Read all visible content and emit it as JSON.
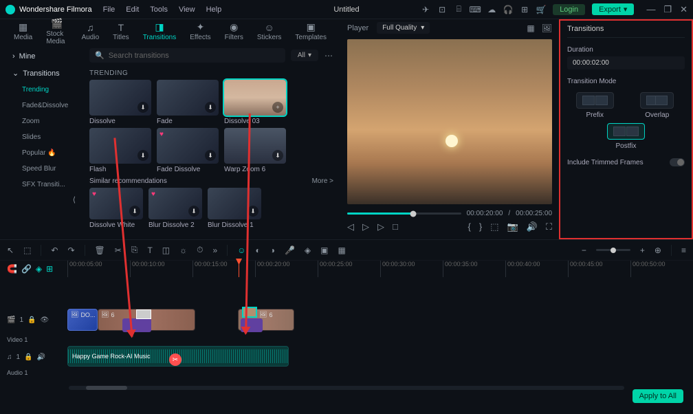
{
  "app": {
    "name": "Wondershare Filmora",
    "doc_title": "Untitled"
  },
  "menu": [
    "File",
    "Edit",
    "Tools",
    "View",
    "Help"
  ],
  "auth": {
    "login": "Login",
    "export": "Export"
  },
  "tabs": [
    {
      "label": "Media"
    },
    {
      "label": "Stock Media"
    },
    {
      "label": "Audio"
    },
    {
      "label": "Titles"
    },
    {
      "label": "Transitions",
      "active": true
    },
    {
      "label": "Effects"
    },
    {
      "label": "Filters"
    },
    {
      "label": "Stickers"
    },
    {
      "label": "Templates"
    }
  ],
  "sidebar": {
    "top": [
      {
        "label": "Mine"
      },
      {
        "label": "Transitions"
      }
    ],
    "sub": [
      {
        "label": "Trending",
        "active": true
      },
      {
        "label": "Fade&Dissolve"
      },
      {
        "label": "Zoom"
      },
      {
        "label": "Slides"
      },
      {
        "label": "Popular 🔥"
      },
      {
        "label": "Speed Blur"
      },
      {
        "label": "SFX Transiti..."
      }
    ]
  },
  "search": {
    "placeholder": "Search transitions",
    "all": "All"
  },
  "sections": {
    "trending": "TRENDING",
    "row1": [
      {
        "label": "Dissolve"
      },
      {
        "label": "Fade"
      },
      {
        "label": "Dissolve 03",
        "selected": true,
        "sunset": true
      }
    ],
    "row2": [
      {
        "label": "Flash"
      },
      {
        "label": "Fade Dissolve",
        "heart": true
      },
      {
        "label": "Warp Zoom 6",
        "city": true
      }
    ],
    "similar": {
      "title": "Similar recommendations",
      "more": "More >"
    },
    "row3": [
      {
        "label": "Dissolve White",
        "heart": true
      },
      {
        "label": "Blur Dissolve 2",
        "heart": true
      },
      {
        "label": "Blur Dissolve 1"
      }
    ]
  },
  "player": {
    "label": "Player",
    "quality": "Full Quality",
    "time_current": "00:00:20:00",
    "time_total": "00:00:25:00"
  },
  "panel": {
    "tab": "Transitions",
    "duration_label": "Duration",
    "duration_value": "00:00:02:00",
    "mode_label": "Transition Mode",
    "modes": [
      {
        "label": "Prefix"
      },
      {
        "label": "Overlap"
      },
      {
        "label": "Postfix",
        "selected": true
      }
    ],
    "include_trimmed": "Include Trimmed Frames"
  },
  "timeline": {
    "ruler": [
      "00:00:05:00",
      "00:00:10:00",
      "00:00:15:00",
      "00:00:20:00",
      "00:00:25:00",
      "00:00:30:00",
      "00:00:35:00",
      "00:00:40:00",
      "00:00:45:00",
      "00:00:50:00"
    ],
    "video_track": "Video 1",
    "audio_track": "Audio 1",
    "clip1_label": "DO...",
    "clip2_count": "6",
    "clip3_count": "6",
    "audio_label": "Happy Game Rock-AI Music",
    "clip1_icons": "🖼"
  },
  "apply_all": "Apply to All"
}
